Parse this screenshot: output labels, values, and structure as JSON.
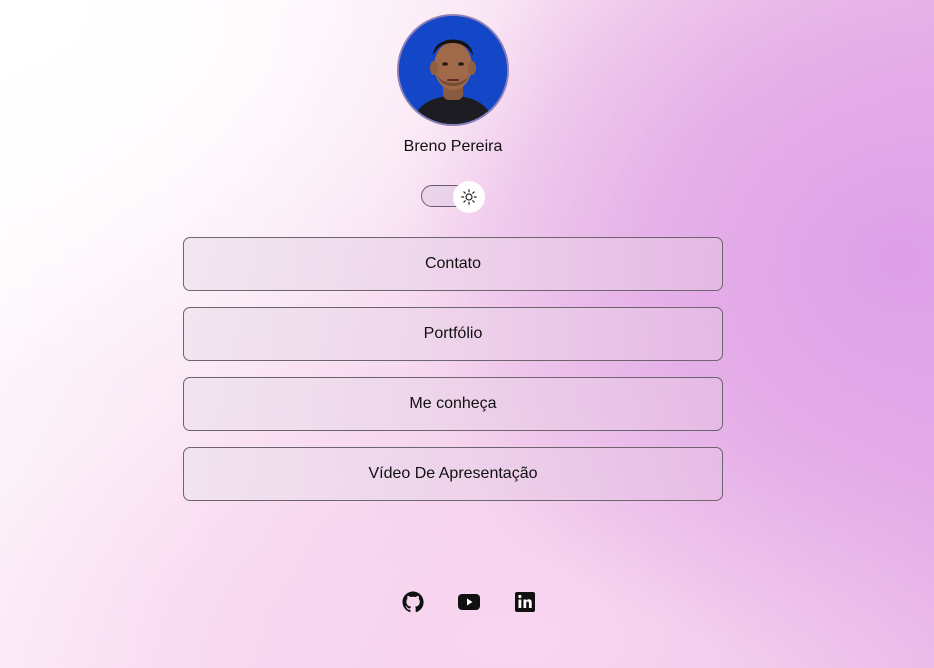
{
  "profile": {
    "name": "Breno Pereira",
    "avatar_icon": "profile-photo"
  },
  "theme_toggle": {
    "state": "light",
    "icon": "sun-icon"
  },
  "links": [
    {
      "label": "Contato"
    },
    {
      "label": "Portfólio"
    },
    {
      "label": "Me conheça"
    },
    {
      "label": "Vídeo De Apresentação"
    }
  ],
  "socials": [
    {
      "icon": "github-icon"
    },
    {
      "icon": "youtube-icon"
    },
    {
      "icon": "linkedin-icon"
    }
  ],
  "colors": {
    "avatar_background": "#1446c8",
    "button_border": "#6e6470",
    "accent_pink": "#e6b0e6"
  }
}
